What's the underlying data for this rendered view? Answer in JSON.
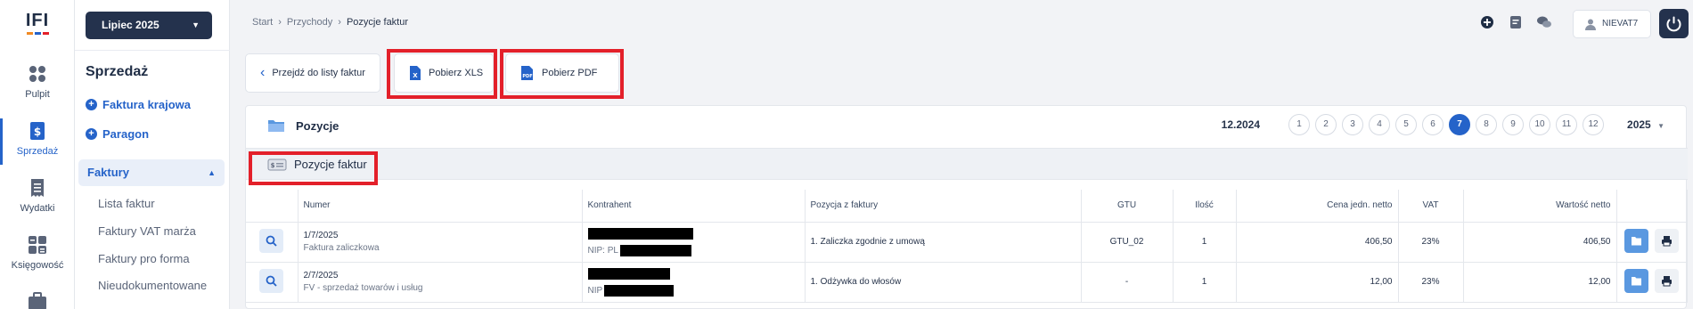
{
  "brand": {
    "logo": "IFI",
    "colors": {
      "accent": "#2563c9",
      "dark": "#24324d",
      "highlight": "#e3202a"
    }
  },
  "rail": [
    {
      "label": "Pulpit",
      "icon": "dashboard-icon"
    },
    {
      "label": "Sprzedaż",
      "icon": "invoice-dollar-icon",
      "active": true
    },
    {
      "label": "Wydatki",
      "icon": "receipt-icon"
    },
    {
      "label": "Księgowość",
      "icon": "calculator-icon"
    },
    {
      "label": "",
      "icon": "briefcase-icon"
    }
  ],
  "sidebar": {
    "period": "Lipiec 2025",
    "title": "Sprzedaż",
    "links": [
      "Faktura krajowa",
      "Paragon"
    ],
    "group": "Faktury",
    "items": [
      "Lista faktur",
      "Faktury VAT marża",
      "Faktury pro forma",
      "Nieudokumentowane"
    ]
  },
  "breadcrumb": [
    "Start",
    "Przychody",
    "Pozycje faktur"
  ],
  "header": {
    "user": "NIEVAT7"
  },
  "actions": {
    "back": "Przejdź do listy faktur",
    "xls": "Pobierz XLS",
    "pdf": "Pobierz PDF"
  },
  "panel": {
    "title": "Pozycje",
    "prev_period": "12.2024",
    "months": [
      "1",
      "2",
      "3",
      "4",
      "5",
      "6",
      "7",
      "8",
      "9",
      "10",
      "11",
      "12"
    ],
    "active_month": "7",
    "year": "2025",
    "section": "Pozycje faktur"
  },
  "table": {
    "columns": [
      "Numer",
      "Kontrahent",
      "Pozycja z faktury",
      "GTU",
      "Ilość",
      "Cena jedn. netto",
      "VAT",
      "Wartość netto"
    ],
    "rows": [
      {
        "number": "1/7/2025",
        "type": "Faktura zaliczkowa",
        "nip": "NIP: PL",
        "item": "1. Zaliczka zgodnie z umową",
        "gtu": "GTU_02",
        "qty": "1",
        "price": "406,50",
        "vat": "23%",
        "net": "406,50"
      },
      {
        "number": "2/7/2025",
        "type": "FV - sprzedaż towarów i usług",
        "nip": "NIP",
        "item": "1. Odżywka do włosów",
        "gtu": "-",
        "qty": "1",
        "price": "12,00",
        "vat": "23%",
        "net": "12,00"
      }
    ]
  }
}
